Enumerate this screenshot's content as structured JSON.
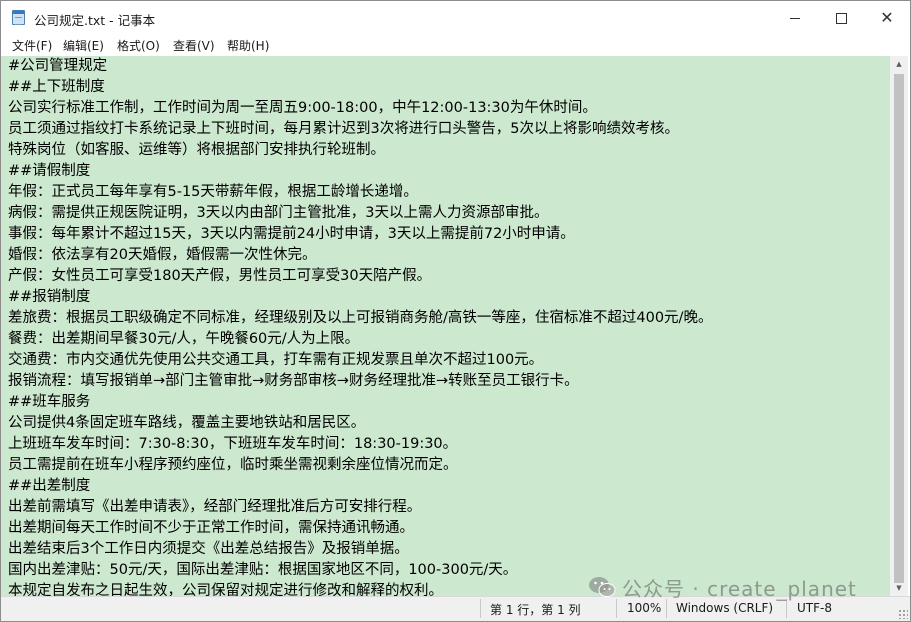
{
  "window": {
    "title": "公司规定.txt - 记事本",
    "controls": {
      "minimize": "",
      "maximize": "",
      "close": "✕"
    }
  },
  "menu": {
    "items": [
      {
        "label": "文件(F)"
      },
      {
        "label": "编辑(E)"
      },
      {
        "label": "格式(O)"
      },
      {
        "label": "查看(V)"
      },
      {
        "label": "帮助(H)"
      }
    ]
  },
  "editor": {
    "background_color": "#cce8cf",
    "lines": [
      "#公司管理规定",
      "##上下班制度",
      "公司实行标准工作制，工作时间为周一至周五9:00-18:00，中午12:00-13:30为午休时间。",
      "员工须通过指纹打卡系统记录上下班时间，每月累计迟到3次将进行口头警告，5次以上将影响绩效考核。",
      "特殊岗位（如客服、运维等）将根据部门安排执行轮班制。",
      "##请假制度",
      "年假：正式员工每年享有5-15天带薪年假，根据工龄增长递增。",
      "病假：需提供正规医院证明，3天以内由部门主管批准，3天以上需人力资源部审批。",
      "事假：每年累计不超过15天，3天以内需提前24小时申请，3天以上需提前72小时申请。",
      "婚假：依法享有20天婚假，婚假需一次性休完。",
      "产假：女性员工可享受180天产假，男性员工可享受30天陪产假。",
      "##报销制度",
      "差旅费：根据员工职级确定不同标准，经理级别及以上可报销商务舱/高铁一等座，住宿标准不超过400元/晚。",
      "餐费：出差期间早餐30元/人，午晚餐60元/人为上限。",
      "交通费：市内交通优先使用公共交通工具，打车需有正规发票且单次不超过100元。",
      "报销流程：填写报销单→部门主管审批→财务部审核→财务经理批准→转账至员工银行卡。",
      "##班车服务",
      "公司提供4条固定班车路线，覆盖主要地铁站和居民区。",
      "上班班车发车时间：7:30-8:30，下班班车发车时间：18:30-19:30。",
      "员工需提前在班车小程序预约座位，临时乘坐需视剩余座位情况而定。",
      "##出差制度",
      "出差前需填写《出差申请表》，经部门经理批准后方可安排行程。",
      "出差期间每天工作时间不少于正常工作时间，需保持通讯畅通。",
      "出差结束后3个工作日内须提交《出差总结报告》及报销单据。",
      "国内出差津贴：50元/天，国际出差津贴：根据国家地区不同，100-300元/天。",
      "本规定自发布之日起生效，公司保留对规定进行修改和解释的权利。"
    ]
  },
  "statusbar": {
    "position": "第 1 行，第 1 列",
    "zoom": "100%",
    "line_ending": "Windows (CRLF)",
    "encoding": "UTF-8"
  },
  "watermark": {
    "text": "公众号 · create_planet",
    "icon": "wechat-icon"
  }
}
